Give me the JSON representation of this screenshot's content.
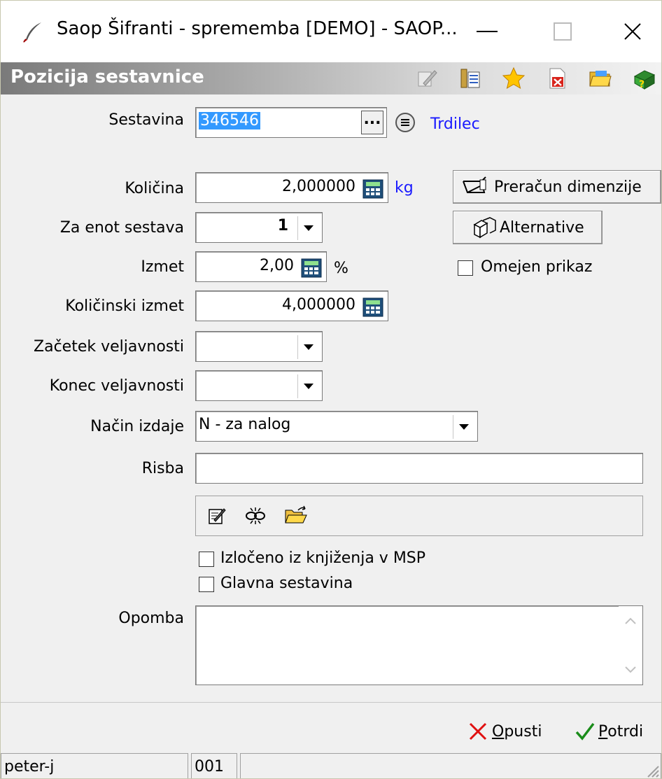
{
  "window": {
    "title": "Saop Šifranti - sprememba [DEMO] - SAOP...",
    "minimize_label": "—",
    "maximize_label": "☐",
    "close_label": "✕"
  },
  "header": {
    "title": "Pozicija sestavnice",
    "toolbar_icons": [
      "edit-note-icon",
      "columns-icon",
      "star-icon",
      "excel-icon",
      "folder-icon",
      "books-help-icon"
    ]
  },
  "form": {
    "sestavina": {
      "label": "Sestavina",
      "value": "346546",
      "browse_label": "...",
      "name": "Trdilec"
    },
    "kolicina": {
      "label": "Količina",
      "value": "2,000000",
      "unit": "kg"
    },
    "za_enot": {
      "label": "Za enot sestava",
      "value": "1"
    },
    "izmet": {
      "label": "Izmet",
      "value": "2,00",
      "unit": "%"
    },
    "kolicinski_izmet": {
      "label": "Količinski izmet",
      "value": "4,000000"
    },
    "zacetek": {
      "label": "Začetek veljavnosti",
      "value": ""
    },
    "konec": {
      "label": "Konec veljavnosti",
      "value": ""
    },
    "nacin_izdaje": {
      "label": "Način izdaje",
      "value": "N - za nalog"
    },
    "risba": {
      "label": "Risba",
      "value": ""
    },
    "izloceno": {
      "label": "Izločeno iz knjiženja v MSP",
      "checked": false
    },
    "glavna": {
      "label": "Glavna sestavina",
      "checked": false
    },
    "opomba": {
      "label": "Opomba",
      "value": ""
    }
  },
  "side": {
    "preracun_label": "Preračun dimenzije",
    "alternative_label": "Alternative",
    "omejen_label": "Omejen prikaz",
    "omejen_checked": false
  },
  "footer": {
    "cancel_label": "Opusti",
    "cancel_accel": "O",
    "cancel_rest": "pusti",
    "confirm_label": "Potrdi",
    "confirm_accel": "P",
    "confirm_rest": "otrdi"
  },
  "statusbar": {
    "user": "peter-j",
    "code": "001",
    "extra": ""
  },
  "colors": {
    "link_blue": "#1a1aff",
    "cancel_red": "#e01010",
    "confirm_green": "#1a8c1a"
  }
}
